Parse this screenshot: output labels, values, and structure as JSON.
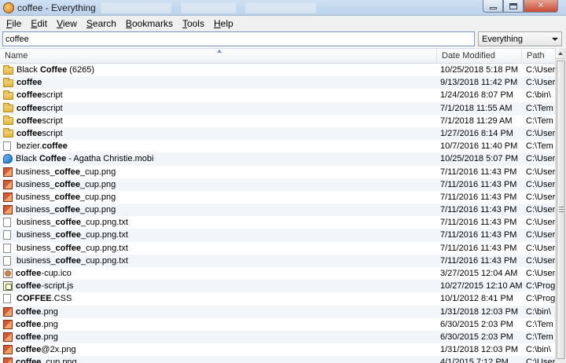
{
  "window": {
    "title": "coffee - Everything"
  },
  "menubar": {
    "items": [
      {
        "label": "File",
        "key": "F",
        "rest": "ile"
      },
      {
        "label": "Edit",
        "key": "E",
        "rest": "dit"
      },
      {
        "label": "View",
        "key": "V",
        "rest": "iew"
      },
      {
        "label": "Search",
        "key": "S",
        "rest": "earch"
      },
      {
        "label": "Bookmarks",
        "key": "B",
        "rest": "ookmarks"
      },
      {
        "label": "Tools",
        "key": "T",
        "rest": "ools"
      },
      {
        "label": "Help",
        "key": "H",
        "rest": "elp"
      }
    ]
  },
  "search": {
    "value": "coffee",
    "filter": "Everything"
  },
  "table": {
    "columns": {
      "name": "Name",
      "date": "Date Modified",
      "path": "Path"
    },
    "rows": [
      {
        "icon": "folder-icon",
        "pre": "Black ",
        "match": "Coffee",
        "post": " (6265)",
        "date": "10/25/2018 5:18 PM",
        "path": "C:\\User"
      },
      {
        "icon": "folder-icon",
        "pre": "",
        "match": "coffee",
        "post": "",
        "date": "9/13/2018 11:42 PM",
        "path": "C:\\User"
      },
      {
        "icon": "folder-icon",
        "pre": "",
        "match": "coffee",
        "post": "script",
        "date": "1/24/2016 8:07 PM",
        "path": "C:\\bin\\"
      },
      {
        "icon": "folder-icon",
        "pre": "",
        "match": "coffee",
        "post": "script",
        "date": "7/1/2018 11:55 AM",
        "path": "C:\\Tem"
      },
      {
        "icon": "folder-icon",
        "pre": "",
        "match": "coffee",
        "post": "script",
        "date": "7/1/2018 11:29 AM",
        "path": "C:\\Tem"
      },
      {
        "icon": "folder-icon",
        "pre": "",
        "match": "coffee",
        "post": "script",
        "date": "1/27/2016 8:14 PM",
        "path": "C:\\User"
      },
      {
        "icon": "doc-icon",
        "pre": "bezier.",
        "match": "coffee",
        "post": "",
        "date": "10/7/2016 11:40 PM",
        "path": "C:\\Tem"
      },
      {
        "icon": "mobi-icon",
        "pre": "Black ",
        "match": "Coffee",
        "post": " - Agatha Christie.mobi",
        "date": "10/25/2018 5:07 PM",
        "path": "C:\\User"
      },
      {
        "icon": "png-icon",
        "pre": "business_",
        "match": "coffee",
        "post": "_cup.png",
        "date": "7/11/2016 11:43 PM",
        "path": "C:\\User"
      },
      {
        "icon": "png-icon",
        "pre": "business_",
        "match": "coffee",
        "post": "_cup.png",
        "date": "7/11/2016 11:43 PM",
        "path": "C:\\User"
      },
      {
        "icon": "png-icon",
        "pre": "business_",
        "match": "coffee",
        "post": "_cup.png",
        "date": "7/11/2016 11:43 PM",
        "path": "C:\\User"
      },
      {
        "icon": "png-icon",
        "pre": "business_",
        "match": "coffee",
        "post": "_cup.png",
        "date": "7/11/2016 11:43 PM",
        "path": "C:\\User"
      },
      {
        "icon": "doc-icon",
        "pre": "business_",
        "match": "coffee",
        "post": "_cup.png.txt",
        "date": "7/11/2016 11:43 PM",
        "path": "C:\\User"
      },
      {
        "icon": "doc-icon",
        "pre": "business_",
        "match": "coffee",
        "post": "_cup.png.txt",
        "date": "7/11/2016 11:43 PM",
        "path": "C:\\User"
      },
      {
        "icon": "doc-icon",
        "pre": "business_",
        "match": "coffee",
        "post": "_cup.png.txt",
        "date": "7/11/2016 11:43 PM",
        "path": "C:\\User"
      },
      {
        "icon": "doc-icon",
        "pre": "business_",
        "match": "coffee",
        "post": "_cup.png.txt",
        "date": "7/11/2016 11:43 PM",
        "path": "C:\\User"
      },
      {
        "icon": "ico-icon",
        "pre": "",
        "match": "coffee",
        "post": "-cup.ico",
        "date": "3/27/2015 12:04 AM",
        "path": "C:\\User"
      },
      {
        "icon": "js-icon",
        "pre": "",
        "match": "coffee",
        "post": "-script.js",
        "date": "10/27/2015 12:10 AM",
        "path": "C:\\Prog"
      },
      {
        "icon": "css-icon",
        "pre": "",
        "match": "COFFEE",
        "post": ".CSS",
        "date": "10/1/2012 8:41 PM",
        "path": "C:\\Prog"
      },
      {
        "icon": "png-icon",
        "pre": "",
        "match": "coffee",
        "post": ".png",
        "date": "1/31/2018 12:03 PM",
        "path": "C:\\bin\\"
      },
      {
        "icon": "png-icon",
        "pre": "",
        "match": "coffee",
        "post": ".png",
        "date": "6/30/2015 2:03 PM",
        "path": "C:\\Tem"
      },
      {
        "icon": "png-icon",
        "pre": "",
        "match": "coffee",
        "post": ".png",
        "date": "6/30/2015 2:03 PM",
        "path": "C:\\Tem"
      },
      {
        "icon": "png-icon",
        "pre": "",
        "match": "coffee",
        "post": "@2x.png",
        "date": "1/31/2018 12:03 PM",
        "path": "C:\\bin\\"
      },
      {
        "icon": "png-icon",
        "pre": "",
        "match": "coffee",
        "post": "_cup.png",
        "date": "4/1/2015 7:12 PM",
        "path": "C:\\User"
      }
    ]
  },
  "colors": {
    "titlebar": "#c6daf0",
    "row_alt": "#f2f5fa",
    "close_button": "#c94a33"
  }
}
